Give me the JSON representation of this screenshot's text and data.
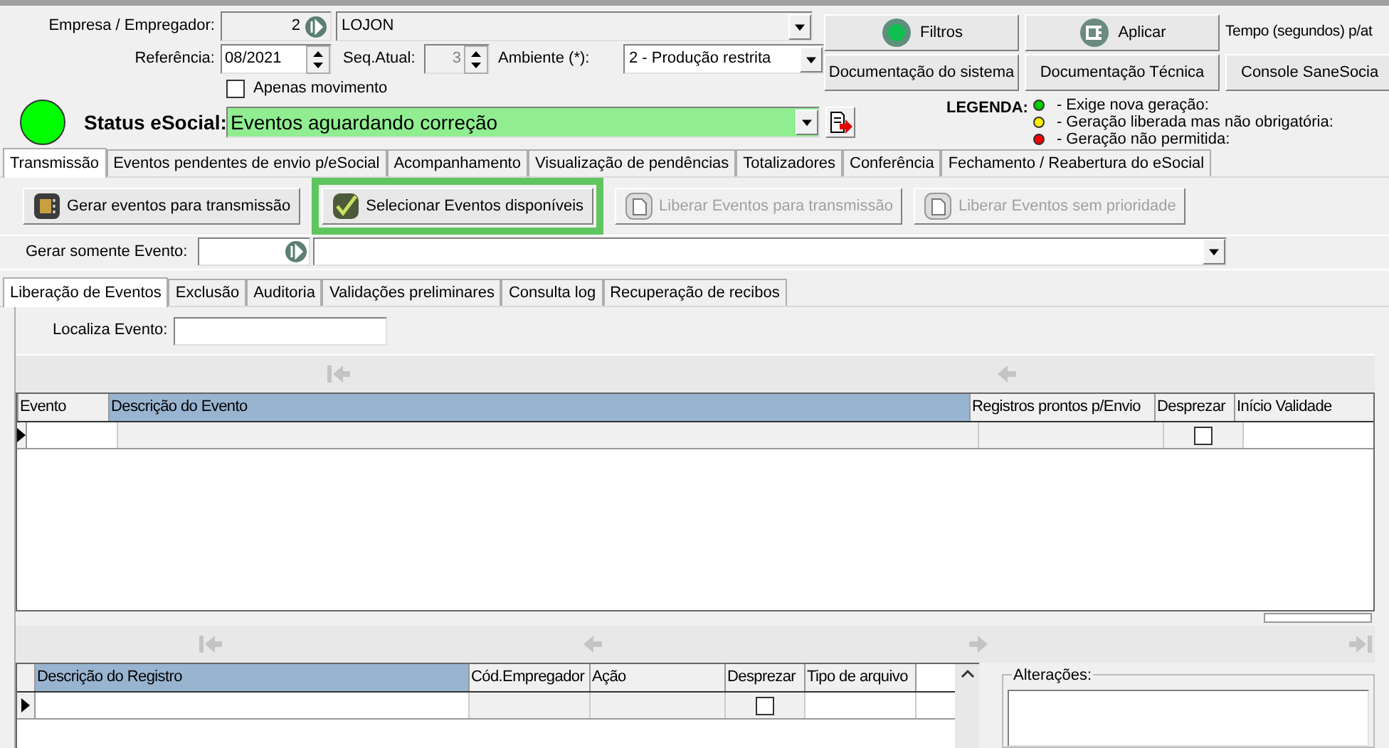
{
  "header": {
    "company": {
      "label": "Empresa / Empregador:",
      "code": "2",
      "name": "LOJON"
    },
    "reference": {
      "label": "Referência:",
      "value": "08/2021"
    },
    "sequence": {
      "label": "Seq.Atual:",
      "value": "3",
      "disabled": true
    },
    "environment": {
      "label": "Ambiente (*):",
      "value": "2 - Produção restrita"
    },
    "only_movement": {
      "label": "Apenas movimento",
      "checked": false
    },
    "status": {
      "label": "Status eSocial:",
      "value": "Eventos aguardando correção",
      "color": "#90ee90"
    },
    "buttons": [
      {
        "label": "Filtros"
      },
      {
        "label": "Aplicar"
      },
      {
        "label": "Documentação do sistema"
      },
      {
        "label": "Documentação Técnica"
      }
    ],
    "time_label": "Tempo (segundos) p/at",
    "console_button": "Console SaneSocia",
    "legend": {
      "title": "LEGENDA:",
      "items": [
        {
          "text": "- Exige nova geração:",
          "color": "#00cc00"
        },
        {
          "text": "- Geração liberada mas não obrigatória:",
          "color": "#ffee00"
        },
        {
          "text": "- Geração não permitida:",
          "color": "#ee0000"
        }
      ]
    }
  },
  "tabs": [
    {
      "label": "Transmissão",
      "selected": true
    },
    {
      "label": "Eventos pendentes de envio p/eSocial",
      "selected": false
    },
    {
      "label": "Acompanhamento",
      "selected": false
    },
    {
      "label": "Visualização de pendências",
      "selected": false
    },
    {
      "label": "Totalizadores",
      "selected": false
    },
    {
      "label": "Conferência",
      "selected": false
    },
    {
      "label": "Fechamento / Reabertura do eSocial",
      "selected": false
    }
  ],
  "actions": [
    {
      "label": "Gerar eventos para transmissão",
      "disabled": false,
      "highlighted": false
    },
    {
      "label": "Selecionar Eventos disponíveis",
      "disabled": false,
      "highlighted": true
    },
    {
      "label": "Liberar Eventos para transmissão",
      "disabled": true,
      "highlighted": false
    },
    {
      "label": "Liberar Eventos sem prioridade",
      "disabled": true,
      "highlighted": false
    }
  ],
  "event_filter": {
    "label": "Gerar somente Evento:"
  },
  "subtabs": [
    {
      "label": "Liberação de Eventos",
      "selected": true
    },
    {
      "label": "Exclusão",
      "selected": false
    },
    {
      "label": "Auditoria",
      "selected": false
    },
    {
      "label": "Validações preliminares",
      "selected": false
    },
    {
      "label": "Consulta log",
      "selected": false
    },
    {
      "label": "Recuperação de recibos",
      "selected": false
    }
  ],
  "search": {
    "label": "Localiza Evento:"
  },
  "events_table": {
    "columns": [
      {
        "label": "Evento",
        "selected": false
      },
      {
        "label": "Descrição do Evento",
        "selected": true
      },
      {
        "label": "Registros prontos p/Envio",
        "selected": false
      },
      {
        "label": "Desprezar",
        "selected": false
      },
      {
        "label": "Início Validade",
        "selected": false
      }
    ],
    "rows": [
      {
        "discard": false
      }
    ]
  },
  "records_table": {
    "columns": [
      {
        "label": "Descrição do Registro",
        "selected": true
      },
      {
        "label": "Cód.Empregador",
        "selected": false
      },
      {
        "label": "Ação",
        "selected": false
      },
      {
        "label": "Desprezar",
        "selected": false
      },
      {
        "label": "Tipo de arquivo",
        "selected": false
      }
    ],
    "rows": [
      {
        "discard": false
      }
    ]
  },
  "changes": {
    "label": "Alterações:"
  }
}
